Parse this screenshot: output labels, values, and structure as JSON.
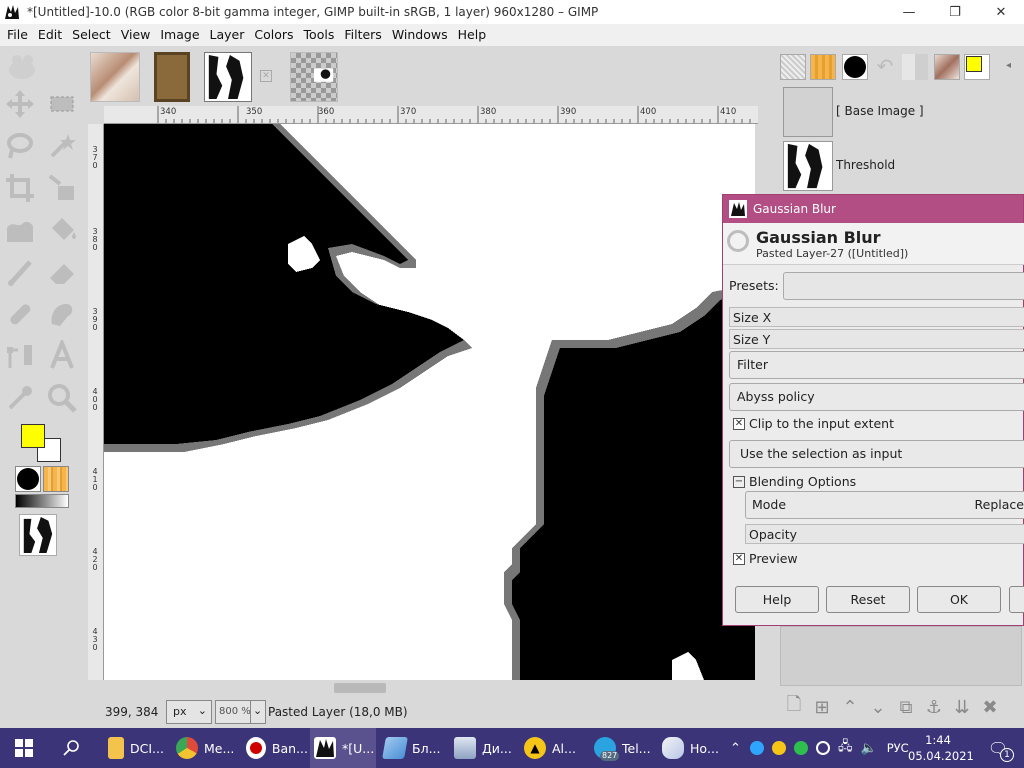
{
  "window": {
    "title": "*[Untitled]-10.0 (RGB color 8-bit gamma integer, GIMP built-in sRGB, 1 layer) 960x1280 – GIMP"
  },
  "menu": [
    "File",
    "Edit",
    "Select",
    "View",
    "Image",
    "Layer",
    "Colors",
    "Tools",
    "Filters",
    "Windows",
    "Help"
  ],
  "rulers": {
    "horizontal": [
      "340",
      "350",
      "360",
      "370",
      "380",
      "390",
      "400",
      "410"
    ],
    "vertical": [
      "370",
      "380",
      "390",
      "400",
      "410",
      "420",
      "430"
    ]
  },
  "statusbar": {
    "coords": "399, 384",
    "unit": "px",
    "zoom": "800 %",
    "layer_info": "Pasted Layer (18,0 MB)"
  },
  "layers": [
    {
      "name": "[ Base Image ]"
    },
    {
      "name": "Threshold"
    }
  ],
  "colors": {
    "foreground": "#ffff00",
    "background": "#ffffff",
    "dialog_titlebar": "#b34e84",
    "taskbar": "#3b3478"
  },
  "dialog": {
    "window_title": "Gaussian Blur",
    "heading": "Gaussian Blur",
    "subtitle": "Pasted Layer-27 ([Untitled])",
    "presets_label": "Presets:",
    "size_x_label": "Size X",
    "size_y_label": "Size Y",
    "filter_label": "Filter",
    "abyss_label": "Abyss policy",
    "clip_label": "Clip to the input extent",
    "clip_checked": true,
    "selection_button": "Use the selection as input",
    "blending_label": "Blending Options",
    "mode_label": "Mode",
    "mode_value": "Replace",
    "opacity_label": "Opacity",
    "preview_label": "Preview",
    "preview_checked": true,
    "buttons": {
      "help": "Help",
      "reset": "Reset",
      "ok": "OK"
    }
  },
  "taskbar": {
    "items": [
      {
        "label": "DCI...",
        "icon": "folder-icon"
      },
      {
        "label": "Ме...",
        "icon": "chrome-icon"
      },
      {
        "label": "Ban...",
        "icon": "record-icon"
      },
      {
        "label": "*[U...",
        "icon": "gimp-icon"
      },
      {
        "label": "Бл...",
        "icon": "notepad-icon"
      },
      {
        "label": "Ди...",
        "icon": "image-viewer-icon"
      },
      {
        "label": "Al...",
        "icon": "archive-icon"
      },
      {
        "label": "Tel...",
        "icon": "telegram-icon"
      },
      {
        "label": "Но...",
        "icon": "notes-icon"
      }
    ],
    "telegram_badge": "827",
    "language": "РУС",
    "time": "1:44",
    "date": "05.04.2021",
    "notification_count": "1"
  }
}
